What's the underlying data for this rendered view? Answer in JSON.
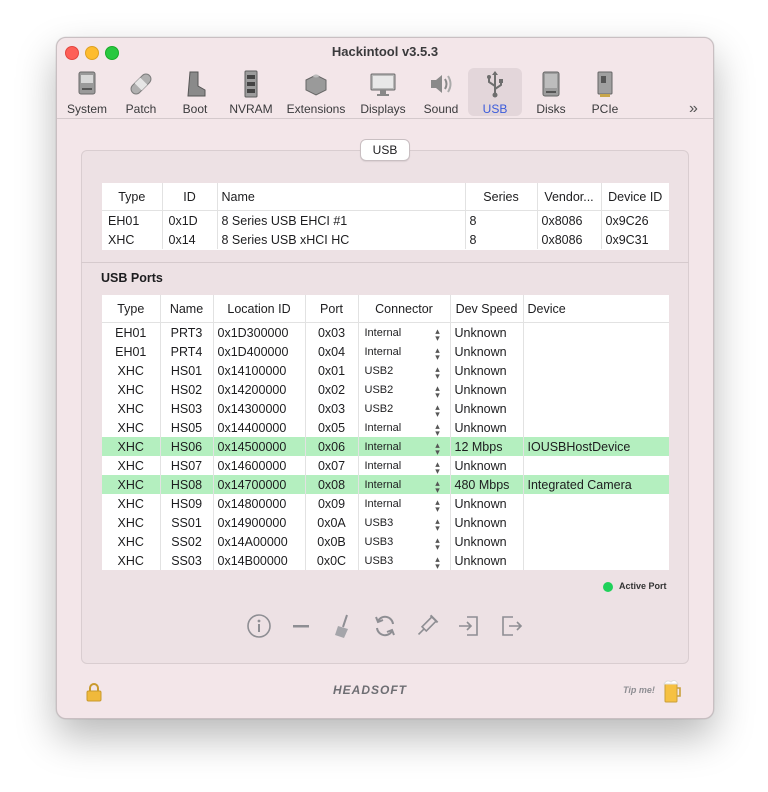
{
  "window": {
    "title": "Hackintool v3.5.3"
  },
  "toolbar": {
    "items": [
      {
        "label": "System",
        "icon": "computer-icon"
      },
      {
        "label": "Patch",
        "icon": "bandage-icon"
      },
      {
        "label": "Boot",
        "icon": "boot-icon"
      },
      {
        "label": "NVRAM",
        "icon": "memory-chip-icon"
      },
      {
        "label": "Extensions",
        "icon": "lego-brick-icon"
      },
      {
        "label": "Displays",
        "icon": "monitor-icon"
      },
      {
        "label": "Sound",
        "icon": "speaker-icon"
      },
      {
        "label": "USB",
        "icon": "usb-icon"
      },
      {
        "label": "Disks",
        "icon": "disk-icon"
      },
      {
        "label": "PCIe",
        "icon": "pcie-card-icon"
      }
    ],
    "active": "USB",
    "more": "»"
  },
  "tab": {
    "label": "USB"
  },
  "controllers": {
    "headers": [
      "Type",
      "ID",
      "Name",
      "Series",
      "Vendor...",
      "Device ID"
    ],
    "rows": [
      [
        "EH01",
        "0x1D",
        "8 Series USB EHCI #1",
        "8",
        "0x8086",
        "0x9C26"
      ],
      [
        "XHC",
        "0x14",
        "8 Series USB xHCI HC",
        "8",
        "0x8086",
        "0x9C31"
      ]
    ]
  },
  "ports": {
    "title": "USB Ports",
    "headers": [
      "Type",
      "Name",
      "Location ID",
      "Port",
      "Connector",
      "Dev Speed",
      "Device"
    ],
    "rows": [
      [
        "EH01",
        "PRT3",
        "0x1D300000",
        "0x03",
        "Internal",
        "Unknown",
        ""
      ],
      [
        "EH01",
        "PRT4",
        "0x1D400000",
        "0x04",
        "Internal",
        "Unknown",
        ""
      ],
      [
        "XHC",
        "HS01",
        "0x14100000",
        "0x01",
        "USB2",
        "Unknown",
        ""
      ],
      [
        "XHC",
        "HS02",
        "0x14200000",
        "0x02",
        "USB2",
        "Unknown",
        ""
      ],
      [
        "XHC",
        "HS03",
        "0x14300000",
        "0x03",
        "USB2",
        "Unknown",
        ""
      ],
      [
        "XHC",
        "HS05",
        "0x14400000",
        "0x05",
        "Internal",
        "Unknown",
        ""
      ],
      [
        "XHC",
        "HS06",
        "0x14500000",
        "0x06",
        "Internal",
        "12 Mbps",
        "IOUSBHostDevice"
      ],
      [
        "XHC",
        "HS07",
        "0x14600000",
        "0x07",
        "Internal",
        "Unknown",
        ""
      ],
      [
        "XHC",
        "HS08",
        "0x14700000",
        "0x08",
        "Internal",
        "480 Mbps",
        "Integrated Camera"
      ],
      [
        "XHC",
        "HS09",
        "0x14800000",
        "0x09",
        "Internal",
        "Unknown",
        ""
      ],
      [
        "XHC",
        "SS01",
        "0x14900000",
        "0x0A",
        "USB3",
        "Unknown",
        ""
      ],
      [
        "XHC",
        "SS02",
        "0x14A00000",
        "0x0B",
        "USB3",
        "Unknown",
        ""
      ],
      [
        "XHC",
        "SS03",
        "0x14B00000",
        "0x0C",
        "USB3",
        "Unknown",
        ""
      ]
    ],
    "active_rows": [
      6,
      8
    ],
    "active_color": "#b4efbf"
  },
  "legend": {
    "label": "Active Port",
    "color": "#1fd15a"
  },
  "actions": [
    {
      "name": "info-icon"
    },
    {
      "name": "remove-icon"
    },
    {
      "name": "broom-icon"
    },
    {
      "name": "refresh-icon"
    },
    {
      "name": "inject-icon"
    },
    {
      "name": "import-icon"
    },
    {
      "name": "export-icon"
    }
  ],
  "footer": {
    "logo": "HEADSOFT",
    "tip": "Tip me!"
  }
}
